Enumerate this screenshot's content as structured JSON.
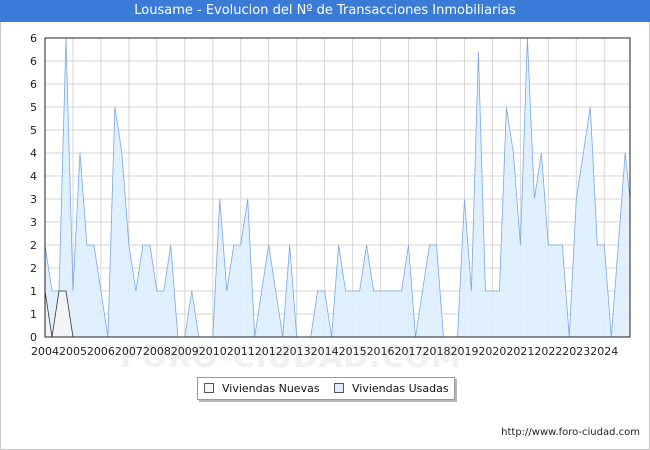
{
  "title": "Lousame - Evolucion del Nº de Transacciones Inmobiliarias",
  "footer_url": "http://www.foro-ciudad.com",
  "watermark": "FORO-CIUDAD.COM",
  "colors": {
    "title_bar": "#3b7bd8",
    "series_nuevas_fill": "#f4f4f4",
    "series_nuevas_line": "#333333",
    "series_usadas_fill": "#ddeeff",
    "series_usadas_line": "#7aa7e0",
    "grid": "#d6d6d6"
  },
  "chart_data": {
    "type": "area",
    "x_tick_labels": [
      "2004",
      "2005",
      "2006",
      "2007",
      "2008",
      "2009",
      "2010",
      "2011",
      "2012",
      "2013",
      "2014",
      "2015",
      "2016",
      "2017",
      "2018",
      "2019",
      "2020",
      "2021",
      "2022",
      "2023",
      "2024"
    ],
    "y_tick_labels": [
      "0",
      "1",
      "1",
      "2",
      "2",
      "3",
      "3",
      "4",
      "4",
      "5",
      "5",
      "6",
      "6",
      "6"
    ],
    "xlim": [
      2004.0,
      2024.92
    ],
    "ylim": [
      0,
      6.5
    ],
    "grid": true,
    "legend_position": "bottom",
    "series": [
      {
        "name": "Viviendas Nuevas",
        "points": [
          [
            2004.0,
            1
          ],
          [
            2004.25,
            0
          ],
          [
            2004.5,
            1
          ],
          [
            2004.75,
            1
          ],
          [
            2005.0,
            0
          ],
          [
            2005.25,
            0
          ],
          [
            2024.92,
            0
          ]
        ]
      },
      {
        "name": "Viviendas Usadas",
        "points": [
          [
            2004.0,
            2
          ],
          [
            2004.25,
            1
          ],
          [
            2004.5,
            1
          ],
          [
            2004.75,
            6.5
          ],
          [
            2005.0,
            1
          ],
          [
            2005.25,
            4
          ],
          [
            2005.5,
            2
          ],
          [
            2005.75,
            2
          ],
          [
            2006.0,
            1
          ],
          [
            2006.25,
            0
          ],
          [
            2006.5,
            5
          ],
          [
            2006.75,
            4
          ],
          [
            2007.0,
            2
          ],
          [
            2007.25,
            1
          ],
          [
            2007.5,
            2
          ],
          [
            2007.75,
            2
          ],
          [
            2008.0,
            1
          ],
          [
            2008.25,
            1
          ],
          [
            2008.5,
            2
          ],
          [
            2008.75,
            0
          ],
          [
            2009.0,
            0
          ],
          [
            2009.25,
            1
          ],
          [
            2009.5,
            0
          ],
          [
            2009.75,
            0
          ],
          [
            2010.0,
            0
          ],
          [
            2010.25,
            3
          ],
          [
            2010.5,
            1
          ],
          [
            2010.75,
            2
          ],
          [
            2011.0,
            2
          ],
          [
            2011.25,
            3
          ],
          [
            2011.5,
            0
          ],
          [
            2011.75,
            1
          ],
          [
            2012.0,
            2
          ],
          [
            2012.25,
            1
          ],
          [
            2012.5,
            0
          ],
          [
            2012.75,
            2
          ],
          [
            2013.0,
            0
          ],
          [
            2013.25,
            0
          ],
          [
            2013.5,
            0
          ],
          [
            2013.75,
            1
          ],
          [
            2014.0,
            1
          ],
          [
            2014.25,
            0
          ],
          [
            2014.5,
            2
          ],
          [
            2014.75,
            1
          ],
          [
            2015.0,
            1
          ],
          [
            2015.25,
            1
          ],
          [
            2015.5,
            2
          ],
          [
            2015.75,
            1
          ],
          [
            2016.0,
            1
          ],
          [
            2016.25,
            1
          ],
          [
            2016.5,
            1
          ],
          [
            2016.75,
            1
          ],
          [
            2017.0,
            2
          ],
          [
            2017.25,
            0
          ],
          [
            2017.5,
            1
          ],
          [
            2017.75,
            2
          ],
          [
            2018.0,
            2
          ],
          [
            2018.25,
            0
          ],
          [
            2018.5,
            0
          ],
          [
            2018.75,
            0
          ],
          [
            2019.0,
            3
          ],
          [
            2019.25,
            1
          ],
          [
            2019.5,
            6.2
          ],
          [
            2019.75,
            1
          ],
          [
            2020.0,
            1
          ],
          [
            2020.25,
            1
          ],
          [
            2020.5,
            5
          ],
          [
            2020.75,
            4
          ],
          [
            2021.0,
            2
          ],
          [
            2021.25,
            6.5
          ],
          [
            2021.5,
            3
          ],
          [
            2021.75,
            4
          ],
          [
            2022.0,
            2
          ],
          [
            2022.25,
            2
          ],
          [
            2022.5,
            2
          ],
          [
            2022.75,
            0
          ],
          [
            2023.0,
            3
          ],
          [
            2023.25,
            4
          ],
          [
            2023.5,
            5
          ],
          [
            2023.75,
            2
          ],
          [
            2024.0,
            2
          ],
          [
            2024.25,
            0
          ],
          [
            2024.5,
            2
          ],
          [
            2024.75,
            4
          ],
          [
            2024.92,
            3
          ]
        ]
      }
    ]
  }
}
